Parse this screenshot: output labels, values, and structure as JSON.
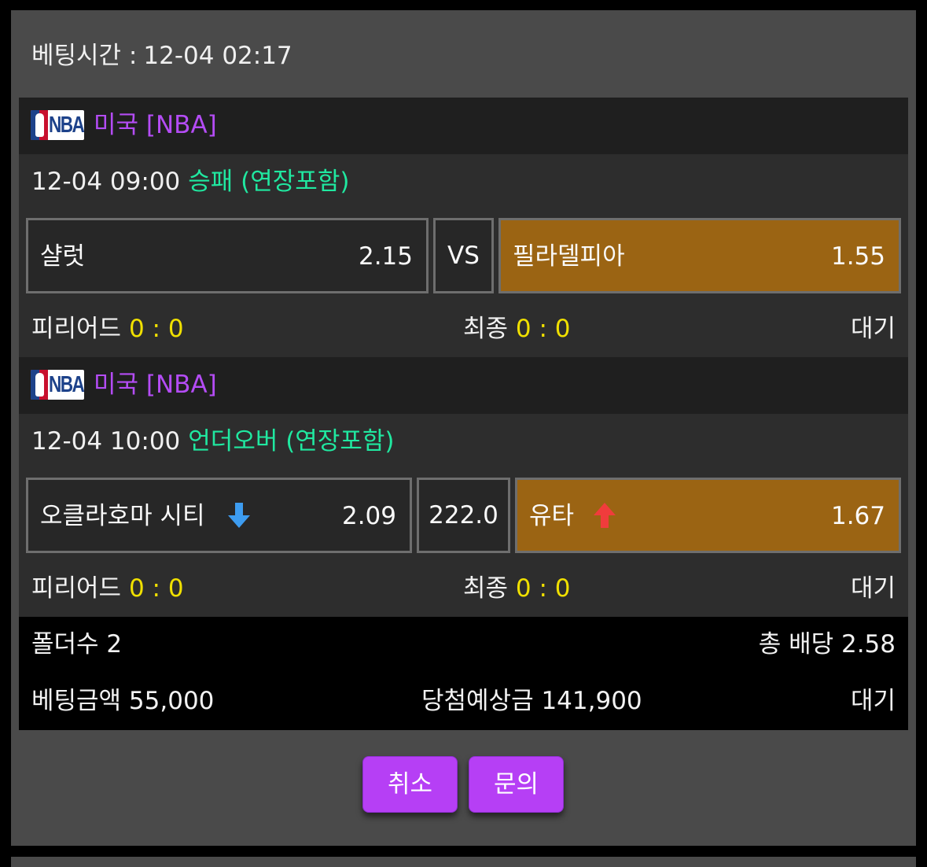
{
  "bet_time": {
    "label": "베팅시간 :",
    "value": "12-04 02:17"
  },
  "games": [
    {
      "league": "미국 [NBA]",
      "time": "12-04 09:00",
      "market": "승패 (연장포함)",
      "home": {
        "team": "샬럿",
        "odd": "2.15"
      },
      "middle": "VS",
      "away": {
        "team": "필라델피아",
        "odd": "1.55"
      },
      "period_label": "피리어드",
      "period_score": "0 : 0",
      "final_label": "최종",
      "final_score": "0 : 0",
      "status": "대기"
    },
    {
      "league": "미국 [NBA]",
      "time": "12-04 10:00",
      "market": "언더오버 (연장포함)",
      "home": {
        "team": "오클라호마 시티",
        "odd": "2.09",
        "icon": "arrow-down-icon"
      },
      "middle": "222.0",
      "away": {
        "team": "유타",
        "odd": "1.67",
        "icon": "arrow-up-icon"
      },
      "period_label": "피리어드",
      "period_score": "0 : 0",
      "final_label": "최종",
      "final_score": "0 : 0",
      "status": "대기"
    }
  ],
  "summary": {
    "folders": "폴더수 2",
    "total_odds": "총 배당 2.58",
    "bet_amount": "베팅금액 55,000",
    "expected_win": "당첨예상금 141,900",
    "status": "대기"
  },
  "buttons": {
    "cancel": "취소",
    "inquiry": "문의"
  },
  "colors": {
    "league": "#b44cf5",
    "market": "#20e8a0",
    "score": "#f0e000",
    "selected": "#9b6413",
    "button": "#b63ff5",
    "arrow_down": "#3d9cf0",
    "arrow_up": "#f03c3c"
  }
}
